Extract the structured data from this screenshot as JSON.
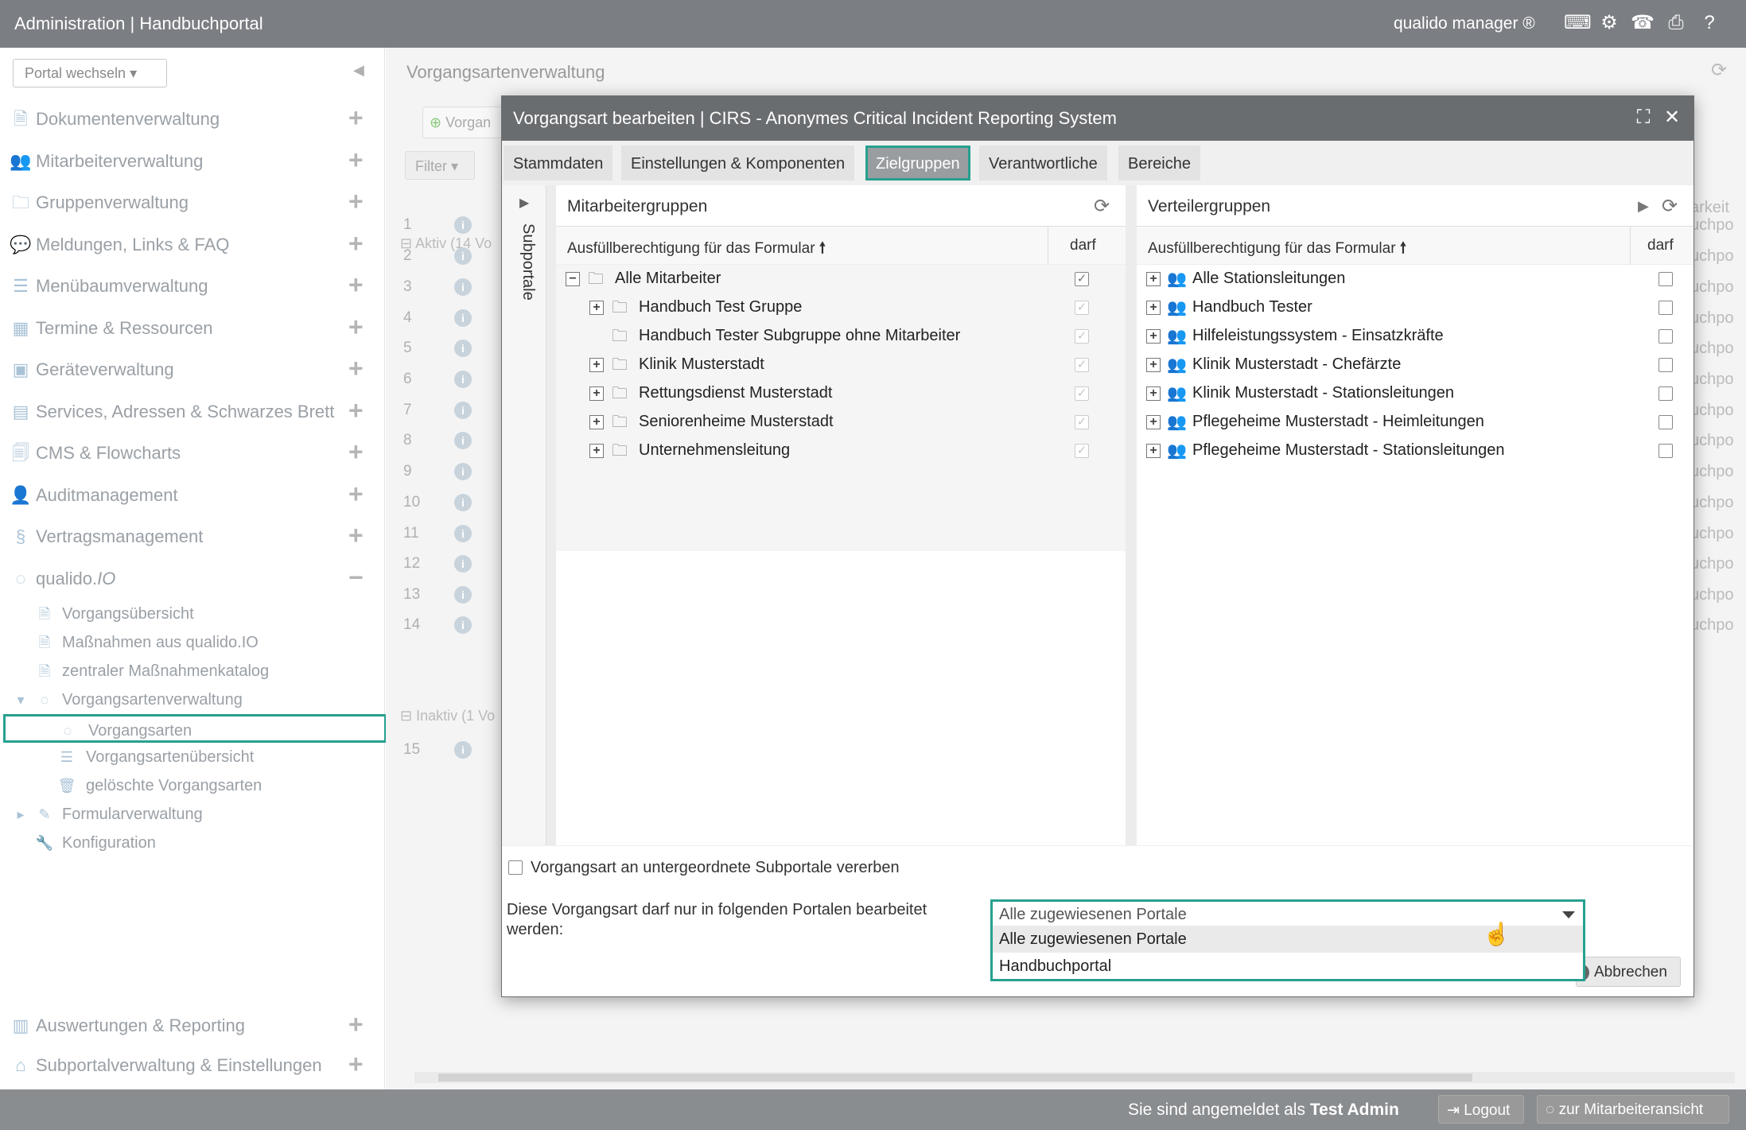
{
  "topbar": {
    "title": "Administration | Handbuchportal",
    "product": "qualido manager ®",
    "icons": [
      "keyboard-icon",
      "gears-icon",
      "fax-icon",
      "print-icon",
      "help-icon"
    ]
  },
  "sidebar": {
    "portal_select": "Portal wechseln",
    "nav": [
      {
        "label": "Dokumentenverwaltung",
        "icon": "document-icon"
      },
      {
        "label": "Mitarbeiterverwaltung",
        "icon": "users-icon"
      },
      {
        "label": "Gruppenverwaltung",
        "icon": "group-folder-icon"
      },
      {
        "label": "Meldungen, Links & FAQ",
        "icon": "chat-icon"
      },
      {
        "label": "Menübaumverwaltung",
        "icon": "list-icon"
      },
      {
        "label": "Termine & Ressourcen",
        "icon": "calendar-icon"
      },
      {
        "label": "Geräteverwaltung",
        "icon": "device-icon"
      },
      {
        "label": "Services, Adressen & Schwarzes Brett",
        "icon": "board-icon"
      },
      {
        "label": "CMS & Flowcharts",
        "icon": "cms-icon"
      },
      {
        "label": "Auditmanagement",
        "icon": "auditor-icon"
      },
      {
        "label": "Vertragsmanagement",
        "icon": "paragraph-icon"
      }
    ],
    "qualido": {
      "label": "qualido.",
      "label_io": "IO"
    },
    "sub": [
      {
        "label": "Vorgangsübersicht"
      },
      {
        "label": "Maßnahmen aus qualido.IO"
      },
      {
        "label": "zentraler Maßnahmenkatalog"
      },
      {
        "label": "Vorgangsartenverwaltung"
      },
      {
        "label": "Vorgangsarten"
      },
      {
        "label": "Vorgangsartenübersicht"
      },
      {
        "label": "gelöschte Vorgangsarten"
      },
      {
        "label": "Formularverwaltung"
      },
      {
        "label": "Konfiguration"
      }
    ],
    "bottom_nav": [
      {
        "label": "Auswertungen & Reporting"
      },
      {
        "label": "Subportalverwaltung & Einstellungen"
      }
    ]
  },
  "main": {
    "title": "Vorgangsartenverwaltung",
    "toolbar_btn": "Vorgan",
    "filter": "Filter",
    "aktiv": "Aktiv (14 Vo",
    "inaktiv": "Inaktiv (1 Vo",
    "rows": [
      "1",
      "2",
      "3",
      "4",
      "5",
      "6",
      "7",
      "8",
      "9",
      "10",
      "11",
      "12",
      "13",
      "14"
    ],
    "inactive_row": "15",
    "right_header": "arkeit",
    "right_cell": "uchpo"
  },
  "modal": {
    "title": "Vorgangsart bearbeiten | CIRS - Anonymes Critical Incident Reporting System",
    "tabs": [
      "Stammdaten",
      "Einstellungen & Komponenten",
      "Zielgruppen",
      "Verantwortliche",
      "Bereiche"
    ],
    "subportale": "Subportale",
    "left": {
      "header": "Mitarbeitergruppen",
      "col_a": "Ausfüllberechtigung für das Formular",
      "col_b": "darf",
      "rows": [
        {
          "label": "Alle Mitarbeiter",
          "level": 0,
          "expand": "−"
        },
        {
          "label": "Handbuch Test Gruppe",
          "level": 1,
          "expand": "+"
        },
        {
          "label": "Handbuch Tester Subgruppe ohne Mitarbeiter",
          "level": 1,
          "expand": ""
        },
        {
          "label": "Klinik Musterstadt",
          "level": 1,
          "expand": "+"
        },
        {
          "label": "Rettungsdienst Musterstadt",
          "level": 1,
          "expand": "+"
        },
        {
          "label": "Seniorenheime Musterstadt",
          "level": 1,
          "expand": "+"
        },
        {
          "label": "Unternehmensleitung",
          "level": 1,
          "expand": "+"
        }
      ]
    },
    "right": {
      "header": "Verteilergruppen",
      "col_a": "Ausfüllberechtigung für das Formular",
      "col_b": "darf",
      "rows": [
        {
          "label": "Alle Stationsleitungen"
        },
        {
          "label": "Handbuch Tester"
        },
        {
          "label": "Hilfeleistungssystem - Einsatzkräfte"
        },
        {
          "label": "Klinik Musterstadt - Chefärzte"
        },
        {
          "label": "Klinik Musterstadt - Stationsleitungen"
        },
        {
          "label": "Pflegeheime Musterstadt - Heimleitungen"
        },
        {
          "label": "Pflegeheime Musterstadt - Stationsleitungen"
        }
      ]
    },
    "inherit_label": "Vorgangsart an untergeordnete Subportale vererben",
    "portal_label": "Diese Vorgangsart darf nur in folgenden Portalen bearbeitet werden:",
    "dropdown_value": "Alle zugewiesenen Portale",
    "dropdown_options": [
      "Alle zugewiesenen Portale",
      "Handbuchportal"
    ],
    "cancel": "Abbrechen"
  },
  "footer": {
    "logged_in_prefix": "Sie sind angemeldet als",
    "user": "Test Admin",
    "logout": "Logout",
    "employee_view": "zur Mitarbeiteransicht"
  },
  "colors": {
    "accent": "#27a08f",
    "header": "#6a6d70",
    "topbar": "#7b7e82"
  }
}
